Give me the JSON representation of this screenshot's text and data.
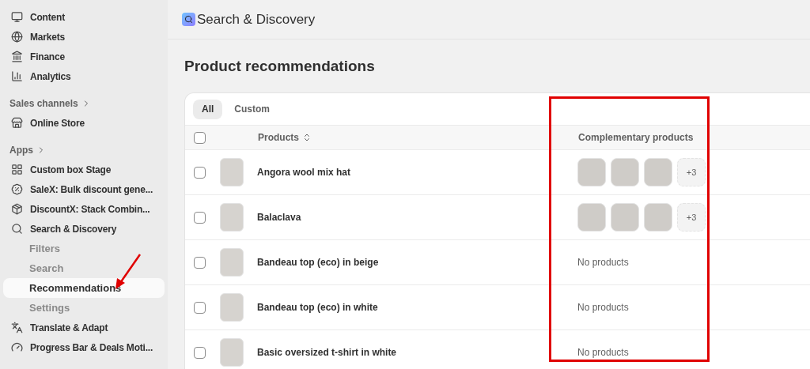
{
  "sidebar": {
    "items": [
      {
        "label": "Content"
      },
      {
        "label": "Markets"
      },
      {
        "label": "Finance"
      },
      {
        "label": "Analytics"
      }
    ],
    "sections": [
      {
        "title": "Sales channels",
        "items": [
          {
            "label": "Online Store"
          }
        ]
      },
      {
        "title": "Apps",
        "items": [
          {
            "label": "Custom box Stage"
          },
          {
            "label": "SaleX: Bulk discount gene..."
          },
          {
            "label": "DiscountX: Stack Combin..."
          },
          {
            "label": "Search & Discovery",
            "children": [
              {
                "label": "Filters",
                "selected": false
              },
              {
                "label": "Search",
                "selected": false
              },
              {
                "label": "Recommendations",
                "selected": true
              },
              {
                "label": "Settings",
                "selected": false
              }
            ]
          },
          {
            "label": "Translate & Adapt"
          },
          {
            "label": "Progress Bar & Deals Moti..."
          }
        ]
      }
    ]
  },
  "header": {
    "app_title": "Search & Discovery"
  },
  "page_title": "Product recommendations",
  "tabs": [
    {
      "label": "All",
      "selected": true
    },
    {
      "label": "Custom",
      "selected": false
    }
  ],
  "table": {
    "select_all": {
      "checked": false
    },
    "columns": [
      "Products",
      "Complementary products"
    ],
    "rows": [
      {
        "name": "Angora wool mix hat",
        "checked": false,
        "complementary": {
          "kind": "images",
          "more": "+3"
        }
      },
      {
        "name": "Balaclava",
        "checked": false,
        "complementary": {
          "kind": "images",
          "more": "+3"
        }
      },
      {
        "name": "Bandeau top (eco) in beige",
        "checked": false,
        "complementary": {
          "kind": "empty",
          "text": "No products"
        }
      },
      {
        "name": "Bandeau top (eco) in white",
        "checked": false,
        "complementary": {
          "kind": "empty",
          "text": "No products"
        }
      },
      {
        "name": "Basic oversized t-shirt in white",
        "checked": false,
        "complementary": {
          "kind": "empty",
          "text": "No products"
        }
      }
    ]
  }
}
